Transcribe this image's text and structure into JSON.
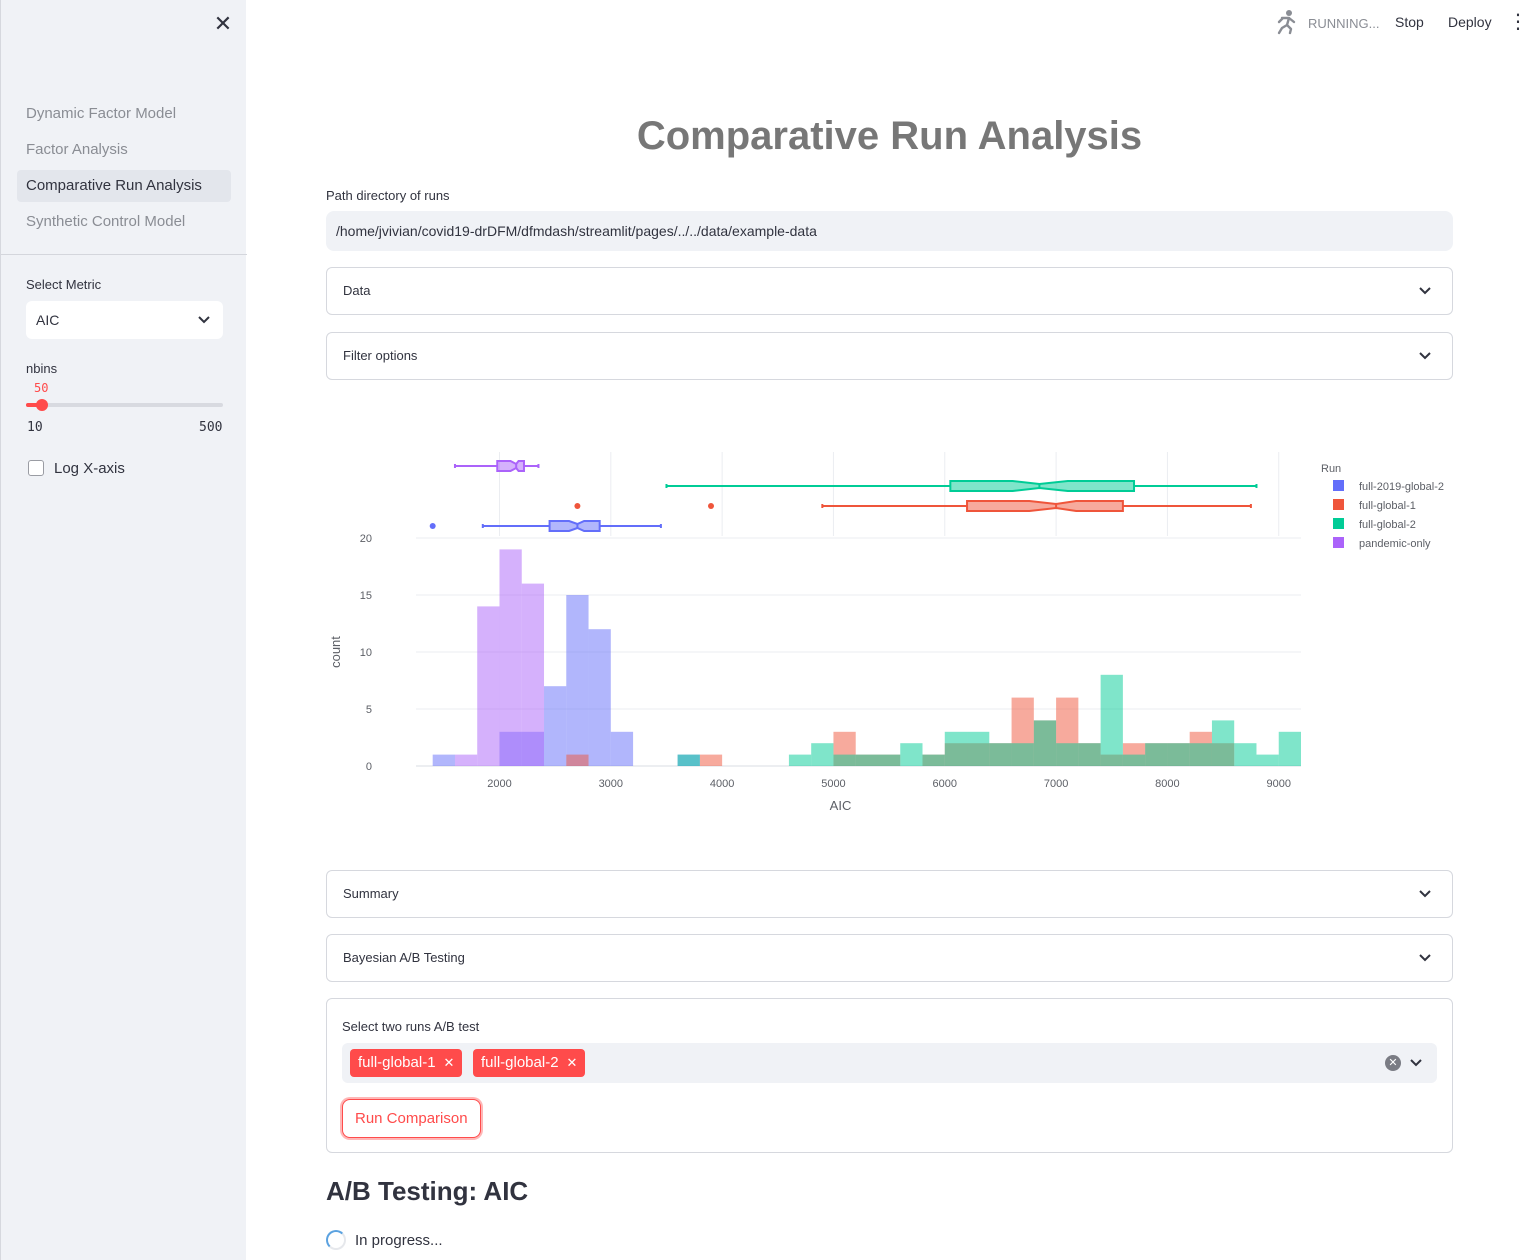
{
  "sidebar": {
    "close_icon": "close-icon",
    "nav": [
      {
        "label": "Dynamic Factor Model",
        "active": false
      },
      {
        "label": "Factor Analysis",
        "active": false
      },
      {
        "label": "Comparative Run Analysis",
        "active": true
      },
      {
        "label": "Synthetic Control Model",
        "active": false
      }
    ],
    "metric": {
      "label": "Select Metric",
      "value": "AIC"
    },
    "nbins": {
      "label": "nbins",
      "value": 50,
      "min": 10,
      "max": 500
    },
    "log_x": {
      "label": "Log X-axis",
      "checked": false
    }
  },
  "header": {
    "status": "RUNNING...",
    "status_icon": "running-figure-icon",
    "stop_label": "Stop",
    "deploy_label": "Deploy",
    "menu_icon": "kebab-menu-icon"
  },
  "main": {
    "title": "Comparative Run Analysis",
    "path_label": "Path directory of runs",
    "path_value": "/home/jvivian/covid19-drDFM/dfmdash/streamlit/pages/../../data/example-data",
    "expanders": [
      "Data",
      "Filter options",
      "Summary",
      "Bayesian A/B Testing"
    ],
    "ab_form": {
      "label": "Select two runs A/B test",
      "selected": [
        "full-global-1",
        "full-global-2"
      ],
      "button": "Run Comparison"
    },
    "ab_title": "A/B Testing: AIC",
    "progress_text": "In progress..."
  },
  "colors": {
    "accent": "#ff4b4b",
    "full-2019-global-2": "#636efa",
    "full-global-1": "#ef553b",
    "full-global-2": "#00cc96",
    "pandemic-only": "#ab63fa"
  },
  "chart_data": {
    "type": "bar",
    "subtype": "overlaid histogram with marginal notched box plots",
    "xlabel": "AIC",
    "ylabel": "count",
    "legend_title": "Run",
    "legend_position": "top-right",
    "xticks": [
      2000,
      3000,
      4000,
      5000,
      6000,
      7000,
      8000,
      9000
    ],
    "yticks": [
      0,
      5,
      10,
      15,
      20
    ],
    "xlim": [
      1250,
      9200
    ],
    "ylim": [
      0,
      20
    ],
    "bin_start": 1400,
    "bin_width": 200,
    "series": [
      {
        "name": "full-2019-global-2",
        "counts": [
          1,
          0,
          0,
          3,
          3,
          7,
          15,
          12,
          3,
          0,
          0,
          1
        ],
        "box": {
          "whisker_low": 1850,
          "q1": 2450,
          "median": 2700,
          "q3": 2900,
          "whisker_high": 3450,
          "outliers": [
            1400
          ]
        }
      },
      {
        "name": "full-global-1",
        "counts": [
          0,
          0,
          0,
          0,
          0,
          0,
          1,
          0,
          0,
          0,
          0,
          0,
          1,
          0,
          0,
          0,
          0,
          0,
          3,
          1,
          1,
          0,
          1,
          2,
          2,
          2,
          6,
          4,
          6,
          2,
          1,
          2,
          2,
          2,
          3,
          2,
          0
        ],
        "box": {
          "whisker_low": 4900,
          "q1": 6200,
          "median": 7000,
          "q3": 7600,
          "whisker_high": 8750,
          "outliers": [
            2700,
            3900
          ]
        }
      },
      {
        "name": "full-global-2",
        "counts": [
          0,
          0,
          0,
          0,
          0,
          0,
          0,
          0,
          0,
          0,
          0,
          1,
          0,
          0,
          0,
          0,
          1,
          2,
          1,
          1,
          1,
          2,
          1,
          3,
          3,
          2,
          2,
          4,
          2,
          2,
          8,
          1,
          2,
          2,
          2,
          4,
          2,
          1,
          3
        ],
        "box": {
          "whisker_low": 3500,
          "q1": 6050,
          "median": 6850,
          "q3": 7700,
          "whisker_high": 8800,
          "outliers": []
        }
      },
      {
        "name": "pandemic-only",
        "counts": [
          0,
          1,
          14,
          19,
          16
        ],
        "box": {
          "whisker_low": 1600,
          "q1": 1980,
          "median": 2150,
          "q3": 2220,
          "whisker_high": 2350,
          "outliers": []
        }
      }
    ]
  }
}
